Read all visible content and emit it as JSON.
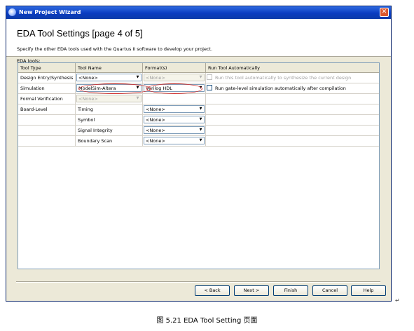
{
  "window": {
    "title": "New Project Wizard",
    "close_glyph": "✕"
  },
  "header": {
    "title": "EDA Tool Settings [page 4 of 5]",
    "subtitle": "Specify the other EDA tools used with the Quartus II software to develop your project."
  },
  "eda_tools_label": "EDA tools:",
  "table": {
    "columns": [
      "Tool Type",
      "Tool Name",
      "Format(s)",
      "Run Tool Automatically"
    ],
    "rows": [
      {
        "type": "Design Entry/Synthesis",
        "tool": "<None>",
        "tool_enabled": true,
        "format": "<None>",
        "format_enabled": false,
        "run_label": "Run this tool automatically to synthesize the current design",
        "run_enabled": false
      },
      {
        "type": "Simulation",
        "tool": "ModelSim-Altera",
        "tool_enabled": true,
        "format": "Verilog HDL",
        "format_enabled": true,
        "run_label": "Run gate-level simulation automatically after compilation",
        "run_enabled": true
      },
      {
        "type": "Formal Verification",
        "tool": "<None>",
        "tool_enabled": false
      },
      {
        "type": "Board-Level",
        "tool": "Timing",
        "format": "<None>"
      },
      {
        "type": "",
        "tool": "Symbol",
        "format": "<None>"
      },
      {
        "type": "",
        "tool": "Signal Integrity",
        "format": "<None>"
      },
      {
        "type": "",
        "tool": "Boundary Scan",
        "format": "<None>"
      }
    ]
  },
  "buttons": {
    "back": "< Back",
    "next": "Next >",
    "finish": "Finish",
    "cancel": "Cancel",
    "help": "Help"
  },
  "caption": "图 5.21 EDA Tool Setting 页面",
  "colors": {
    "title_bar": "#0a3cc1",
    "annotation_oval": "#d03030",
    "dialog_bg": "#ece9d8"
  },
  "icons": {
    "dropdown": "▼",
    "return_mark": "↵"
  }
}
